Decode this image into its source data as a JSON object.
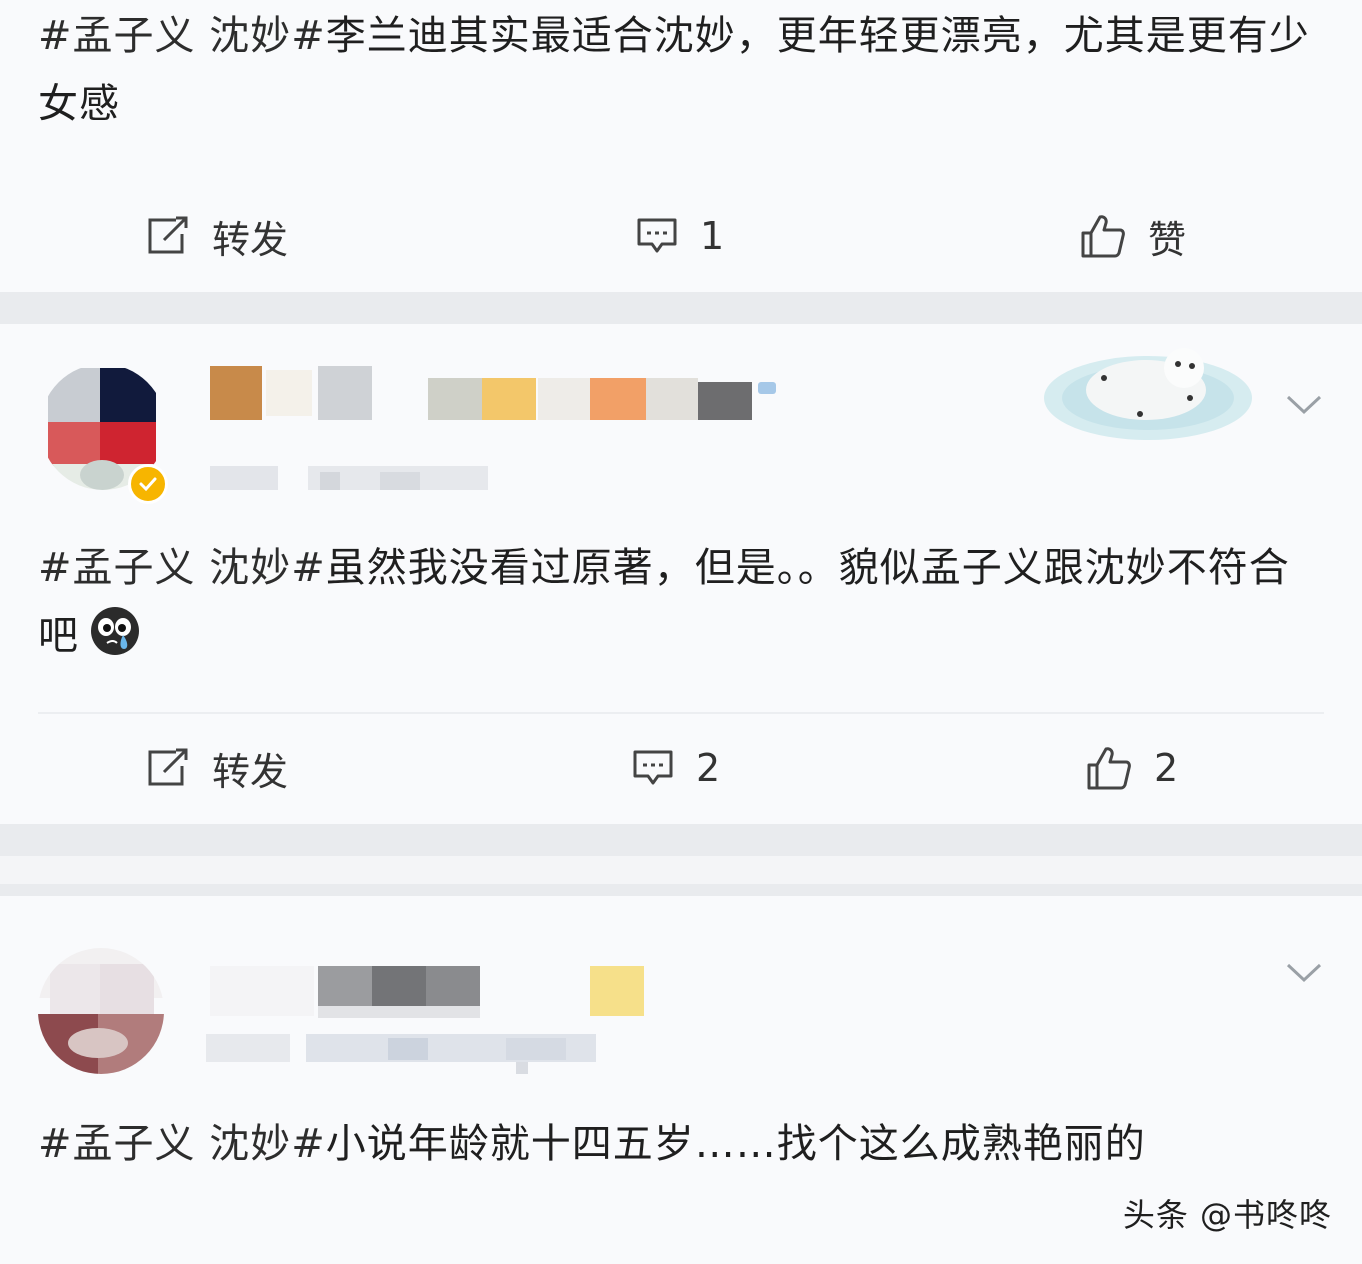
{
  "posts": [
    {
      "topic": "#孟子义 沈妙#",
      "text": "李兰迪其实最适合沈妙，更年轻更漂亮，尤其是更有少女感",
      "actions": {
        "repost": "转发",
        "comments": "1",
        "like": "赞"
      }
    },
    {
      "topic": "#孟子义 沈妙#",
      "text": "虽然我没看过原著，但是。。貌似孟子义跟沈妙不符合吧",
      "emoji": "cry-emoji",
      "actions": {
        "repost": "转发",
        "comments": "2",
        "like": "2"
      }
    },
    {
      "topic": "#孟子义 沈妙#",
      "text": "小说年龄就十四五岁……找个这么成熟艳丽的"
    }
  ],
  "watermark": "头条 @书咚咚",
  "colors": {
    "background": "#f9fafc",
    "separator": "#e9ebee",
    "verified": "#f7b500"
  }
}
